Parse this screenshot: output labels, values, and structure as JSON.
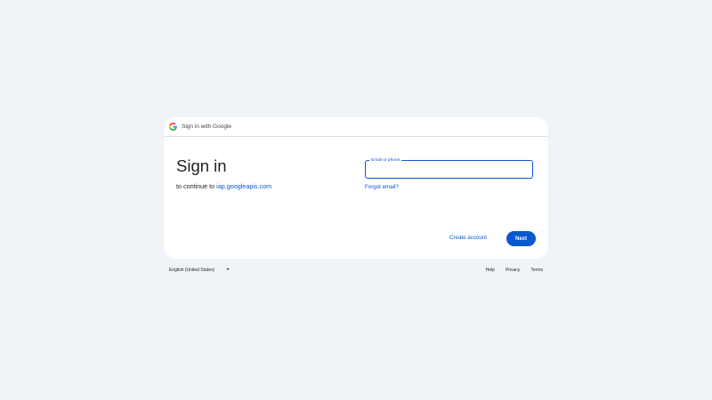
{
  "header": {
    "title": "Sign in with Google",
    "logo_icon": "google-g-icon"
  },
  "main": {
    "title": "Sign in",
    "subtitle_prefix": "to continue to ",
    "subtitle_link": "iap.googleapis.com"
  },
  "email_field": {
    "label": "Email or phone",
    "value": ""
  },
  "links": {
    "forgot_email": "Forgot email?",
    "create_account": "Create account"
  },
  "buttons": {
    "next": "Next"
  },
  "footer": {
    "language": "English (United States)",
    "help": "Help",
    "privacy": "Privacy",
    "terms": "Terms"
  },
  "colors": {
    "background": "#f0f4f9",
    "accent": "#0b57d0",
    "card": "#ffffff"
  }
}
